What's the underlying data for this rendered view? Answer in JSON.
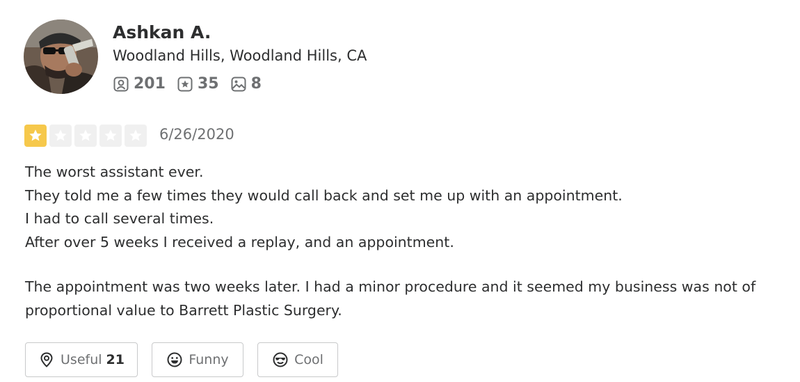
{
  "user": {
    "name": "Ashkan A.",
    "location": "Woodland Hills, Woodland Hills, CA",
    "stats": [
      {
        "icon": "friends-icon",
        "count": "201"
      },
      {
        "icon": "reviews-star-icon",
        "count": "35"
      },
      {
        "icon": "photos-icon",
        "count": "8"
      }
    ]
  },
  "review": {
    "rating": 1,
    "max_rating": 5,
    "date": "6/26/2020",
    "paragraphs": [
      [
        "The worst assistant ever.",
        "They told me a few times they would call back and set me up with an appointment.",
        "I had to call several times.",
        "After over 5 weeks I received a replay, and an appointment."
      ],
      [
        "The appointment was two weeks later. I had a minor procedure and it seemed my business was not of proportional value to Barrett Plastic Surgery."
      ]
    ]
  },
  "reactions": {
    "useful": {
      "label": "Useful",
      "count": "21",
      "icon": "lightbulb-icon"
    },
    "funny": {
      "label": "Funny",
      "icon": "smile-icon"
    },
    "cool": {
      "label": "Cool",
      "icon": "sunglasses-icon"
    }
  },
  "colors": {
    "star_active": "#f6c84b",
    "star_inactive": "#f0f0f0",
    "text": "#2d2e2f",
    "muted": "#6e7072"
  }
}
